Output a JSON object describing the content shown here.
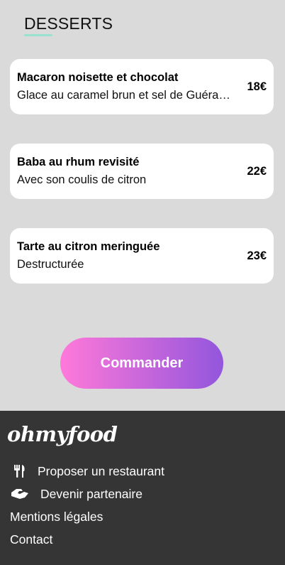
{
  "section": {
    "title": "DESSERTS",
    "accent": "#99e2d0"
  },
  "desserts": [
    {
      "name": "Macaron noisette et chocolat",
      "description": "Glace au caramel brun et sel de Guérande",
      "price": "18€"
    },
    {
      "name": "Baba au rhum revisité",
      "description": "Avec son coulis de citron",
      "price": "22€"
    },
    {
      "name": "Tarte au citron meringuée",
      "description": "Destructurée",
      "price": "23€"
    }
  ],
  "order_button": {
    "label": "Commander",
    "gradient_start": "#ff79da",
    "gradient_end": "#9356dc"
  },
  "footer": {
    "logo": "ohmyfood",
    "links": [
      {
        "label": "Proposer un restaurant",
        "icon": "utensils-icon"
      },
      {
        "label": "Devenir partenaire",
        "icon": "handshake-icon"
      },
      {
        "label": "Mentions légales"
      },
      {
        "label": "Contact"
      }
    ],
    "background": "#353535"
  }
}
